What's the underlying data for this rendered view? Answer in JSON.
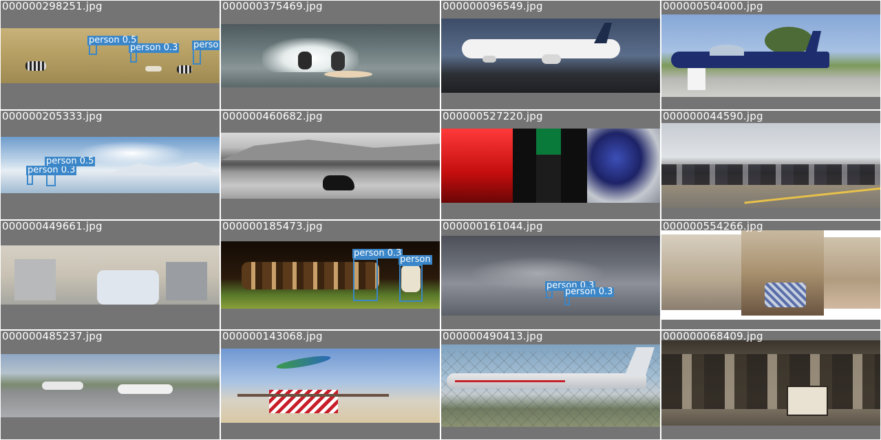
{
  "grid_title": "",
  "tiles": [
    {
      "filename": "000000298251.jpg",
      "detections": [
        {
          "label": "person 0.5"
        },
        {
          "label": "person 0.3"
        },
        {
          "label": "perso"
        }
      ]
    },
    {
      "filename": "000000375469.jpg",
      "detections": []
    },
    {
      "filename": "000000096549.jpg",
      "detections": []
    },
    {
      "filename": "000000504000.jpg",
      "detections": []
    },
    {
      "filename": "000000205333.jpg",
      "detections": [
        {
          "label": "person 0.5"
        },
        {
          "label": "person 0.3"
        }
      ]
    },
    {
      "filename": "000000460682.jpg",
      "detections": []
    },
    {
      "filename": "000000527220.jpg",
      "detections": []
    },
    {
      "filename": "000000044590.jpg",
      "detections": []
    },
    {
      "filename": "000000449661.jpg",
      "detections": []
    },
    {
      "filename": "000000185473.jpg",
      "detections": [
        {
          "label": "person 0.3"
        },
        {
          "label": "person"
        }
      ]
    },
    {
      "filename": "000000161044.jpg",
      "detections": [
        {
          "label": "person 0.3"
        },
        {
          "label": "person 0.3"
        }
      ]
    },
    {
      "filename": "000000554266.jpg",
      "detections": []
    },
    {
      "filename": "000000485237.jpg",
      "detections": []
    },
    {
      "filename": "000000143068.jpg",
      "detections": []
    },
    {
      "filename": "000000490413.jpg",
      "detections": []
    },
    {
      "filename": "000000068409.jpg",
      "detections": []
    }
  ],
  "colors": {
    "tile_background": "#747474",
    "filename_text": "#ffffff",
    "detection_box": "#3a86c8"
  }
}
